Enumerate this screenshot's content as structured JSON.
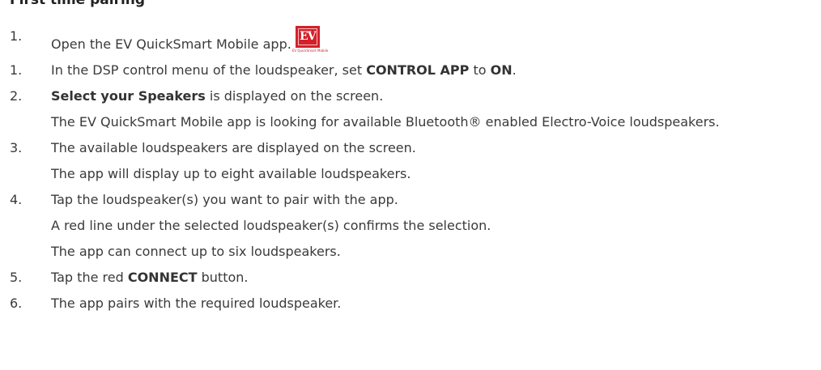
{
  "heading": "First time pairing",
  "app_icon": {
    "logo_text": "EV",
    "caption": "EV QuickSmart Mobile",
    "color": "#d4202a"
  },
  "steps": [
    {
      "number": "1.",
      "lines": [
        "Open the EV QuickSmart Mobile app."
      ]
    },
    {
      "number": "1.",
      "parts": [
        "In the DSP control menu of the loudspeaker, set ",
        "CONTROL APP",
        " to ",
        "ON",
        "."
      ]
    },
    {
      "number": "2.",
      "parts": [
        "Select your Speakers",
        " is displayed on the screen."
      ],
      "lines": [
        "The EV QuickSmart Mobile app is looking for available Bluetooth® enabled Electro-Voice loudspeakers."
      ]
    },
    {
      "number": "3.",
      "lines": [
        "The available loudspeakers are displayed on the screen.",
        "The app will display up to eight available loudspeakers."
      ]
    },
    {
      "number": "4.",
      "lines": [
        "Tap the loudspeaker(s) you want to pair with the app.",
        "A red line under the selected loudspeaker(s) confirms the selection.",
        "The app can connect up to six loudspeakers."
      ]
    },
    {
      "number": "5.",
      "parts": [
        "Tap the red ",
        "CONNECT",
        " button."
      ]
    },
    {
      "number": "6.",
      "lines": [
        "The app pairs with the required loudspeaker."
      ]
    }
  ]
}
